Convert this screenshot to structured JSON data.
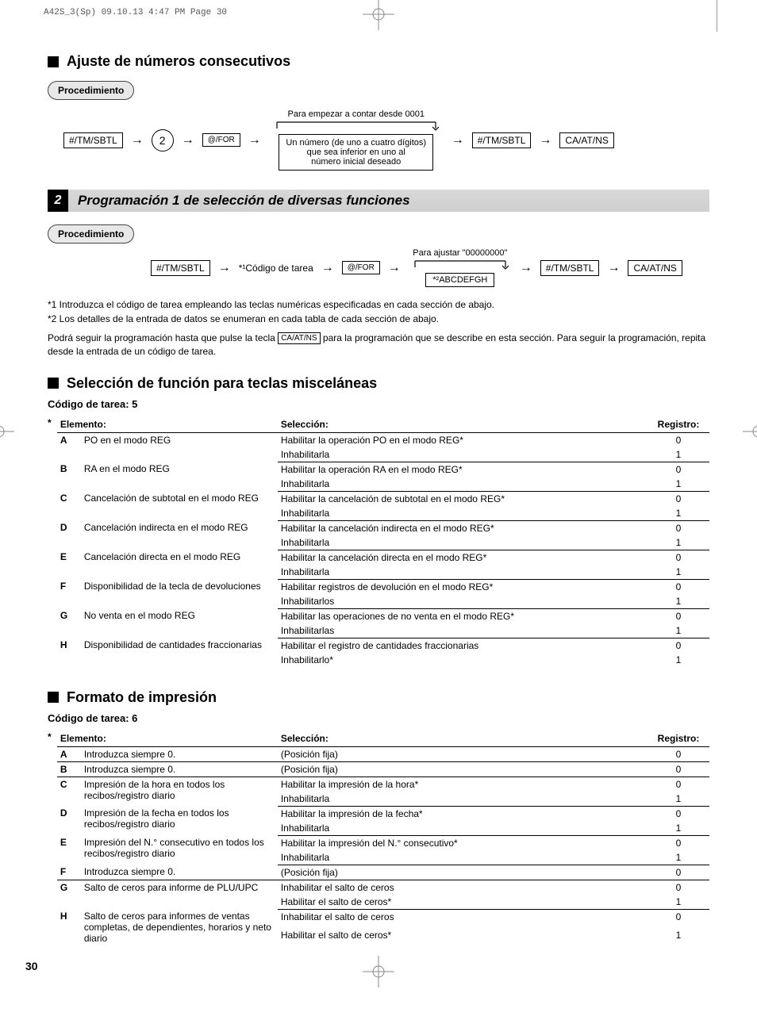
{
  "print_header": "A42S_3(Sp)  09.10.13 4:47 PM  Page 30",
  "sec1": {
    "title": "Ajuste de números consecutivos",
    "proc": "Procedimiento",
    "flow1": {
      "toplabel": "Para empezar a contar desde 0001",
      "k1": "#/TM/SBTL",
      "k2": "2",
      "k3": "@/FOR",
      "box_l1": "Un número (de uno a cuatro dígitos)",
      "box_l2": "que sea inferior en uno al",
      "box_l3": "número inicial deseado",
      "k4": "#/TM/SBTL",
      "k5": "CA/AT/NS"
    }
  },
  "sec2": {
    "num": "2",
    "title": "Programación 1 de selección de diversas funciones",
    "proc": "Procedimiento",
    "flow": {
      "toplabel": "Para ajustar \"00000000\"",
      "k1": "#/TM/SBTL",
      "t1": "*¹Código de tarea",
      "k2": "@/FOR",
      "t2": "*²ABCDEFGH",
      "k3": "#/TM/SBTL",
      "k4": "CA/AT/NS"
    },
    "note1": "*1  Introduzca el código de tarea empleando las teclas numéricas especificadas en cada sección de abajo.",
    "note2": "*2  Los detalles de la entrada de datos se enumeran en cada tabla de cada sección de abajo.",
    "note3a": "Podrá seguir la programación hasta que pulse la tecla ",
    "note3key": "CA/AT/NS",
    "note3b": " para la programación que se describe en esta sección. Para seguir la programación, repita desde la entrada de un código de tarea."
  },
  "tbl_headers": {
    "el": "Elemento:",
    "sel": "Selección:",
    "reg": "Registro:"
  },
  "star": "*",
  "sec3": {
    "title": "Selección de función para teclas misceláneas",
    "code": "Código de tarea: 5",
    "rows": [
      {
        "l": "A",
        "el": "PO en el modo REG",
        "opts": [
          [
            "Habilitar la operación PO en el modo REG*",
            "0"
          ],
          [
            "Inhabilitarla",
            "1"
          ]
        ]
      },
      {
        "l": "B",
        "el": "RA en el modo REG",
        "opts": [
          [
            "Habilitar la operación RA en el modo REG*",
            "0"
          ],
          [
            "Inhabilitarla",
            "1"
          ]
        ]
      },
      {
        "l": "C",
        "el": "Cancelación de subtotal en el modo REG",
        "opts": [
          [
            "Habilitar la cancelación de subtotal en el modo REG*",
            "0"
          ],
          [
            "Inhabilitarla",
            "1"
          ]
        ]
      },
      {
        "l": "D",
        "el": "Cancelación indirecta en el modo REG",
        "opts": [
          [
            "Habilitar la cancelación indirecta en el modo REG*",
            "0"
          ],
          [
            "Inhabilitarla",
            "1"
          ]
        ]
      },
      {
        "l": "E",
        "el": "Cancelación directa en el modo REG",
        "opts": [
          [
            "Habilitar la cancelación directa en el modo REG*",
            "0"
          ],
          [
            "Inhabilitarla",
            "1"
          ]
        ]
      },
      {
        "l": "F",
        "el": "Disponibilidad de la tecla de devoluciones",
        "opts": [
          [
            "Habilitar registros de devolución en el modo REG*",
            "0"
          ],
          [
            "Inhabilitarlos",
            "1"
          ]
        ]
      },
      {
        "l": "G",
        "el": "No venta en el modo REG",
        "opts": [
          [
            "Habilitar las operaciones de no venta en el modo REG*",
            "0"
          ],
          [
            "Inhabilitarlas",
            "1"
          ]
        ]
      },
      {
        "l": "H",
        "el": "Disponibilidad de cantidades fraccionarias",
        "opts": [
          [
            "Habilitar el registro de cantidades fraccionarias",
            "0"
          ],
          [
            "Inhabilitarlo*",
            "1"
          ]
        ]
      }
    ]
  },
  "sec4": {
    "title": "Formato de impresión",
    "code": "Código de tarea: 6",
    "rows": [
      {
        "l": "A",
        "el": "Introduzca siempre 0.",
        "opts": [
          [
            "(Posición fija)",
            "0"
          ]
        ]
      },
      {
        "l": "B",
        "el": "Introduzca siempre 0.",
        "opts": [
          [
            "(Posición fija)",
            "0"
          ]
        ]
      },
      {
        "l": "C",
        "el": "Impresión de la hora en todos los recibos/registro diario",
        "opts": [
          [
            "Habilitar la impresión de la hora*",
            "0"
          ],
          [
            "Inhabilitarla",
            "1"
          ]
        ]
      },
      {
        "l": "D",
        "el": "Impresión de la fecha en todos los recibos/registro diario",
        "opts": [
          [
            "Habilitar la impresión de la fecha*",
            "0"
          ],
          [
            "Inhabilitarla",
            "1"
          ]
        ]
      },
      {
        "l": "E",
        "el": "Impresión del N.° consecutivo en todos los recibos/registro diario",
        "opts": [
          [
            "Habilitar la impresión del N.° consecutivo*",
            "0"
          ],
          [
            "Inhabilitarla",
            "1"
          ]
        ]
      },
      {
        "l": "F",
        "el": "Introduzca siempre 0.",
        "opts": [
          [
            "(Posición fija)",
            "0"
          ]
        ]
      },
      {
        "l": "G",
        "el": "Salto de ceros para informe de PLU/UPC",
        "opts": [
          [
            "Inhabilitar el salto de ceros",
            "0"
          ],
          [
            "Habilitar el salto de ceros*",
            "1"
          ]
        ]
      },
      {
        "l": "H",
        "el": "Salto de ceros para informes de ventas completas, de dependientes, horarios y neto diario",
        "opts": [
          [
            "Inhabilitar el salto de ceros",
            "0"
          ],
          [
            "Habilitar el salto de ceros*",
            "1"
          ]
        ]
      }
    ]
  },
  "page_number": "30"
}
